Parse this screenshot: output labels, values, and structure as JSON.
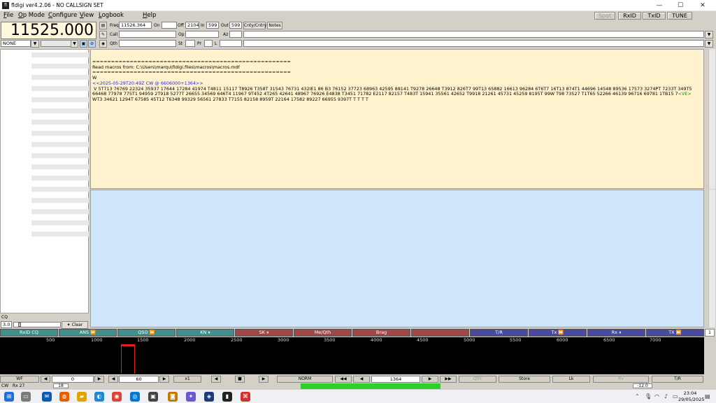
{
  "window": {
    "title": "fldigi ver4.2.06 - NO CALLSIGN SET",
    "icon_text": "fl"
  },
  "window_controls": {
    "minimize": "—",
    "maximize": "☐",
    "close": "✕"
  },
  "menu": [
    "File",
    "Op Mode",
    "Configure",
    "View",
    "Logbook",
    "Help"
  ],
  "mode_buttons": {
    "spot": "Spot",
    "rxid": "RxID",
    "txid": "TxID",
    "tune": "TUNE"
  },
  "log": {
    "frequency_display": "11525.000",
    "freq_label": "Freq",
    "freq_value": "11526.364",
    "on_label": "On",
    "on_value": "",
    "off_label": "Off",
    "off_value": "2104",
    "in_label": "In",
    "in_value": "599",
    "out_label": "Out",
    "out_value": "599",
    "cnty_label": "Cnty/Cntry",
    "notes_label": "Notes",
    "call_label": "Call",
    "op_label": "Op",
    "az_label": "Az",
    "qth_label": "Qth",
    "st_label": "St",
    "pr_label": "Pr",
    "l_label": "L",
    "band_select": "NONE"
  },
  "rx": {
    "line1": "=====================================================",
    "line2": "Read macros from: C:\\Users\\marqu\\fldigi.files\\macros\\macros.mdf",
    "line3": "=====================================================",
    "line4": "W",
    "timestamp": "<<2025-05-29T20:49Z CW @ 6606000+1364>>",
    "body1": " V 5T713 76769 22324 35937 17644 17284 41974 T4811 15117 T8926 T358T 31543 76731 432IE1 86 B3 76152 37723 68963 42595 88141 T9278 26648 T3912 826T7 99T13 65882 16613 96284 6T6T7 16T13 874T1 44696 14548 89536 17573 3274PT 7233T 349T5 66468 77978 775T1 94959 2T918 5277T 26655 34569 646T4 11967 9T452 4T265 42641 48967 76926 E4838 T3451 71782 E2117 82157 T483T 15941 35561 42652 T9918 21261 45731 45259 8195T 99W T98 73527 T1T65 52266 46139 96716 69781 1TB15 7",
    "ve": "<VE>",
    "body2": " WT3 34621 1294T 67585 45T12 T6348 99329 56561 27833 T7155 82158 8959T 22164 17582 89227 66955 9397T T T T T"
  },
  "sidepanel": {
    "cq_label": "CQ",
    "level": "3.0",
    "clear_label": "Clear"
  },
  "macros": [
    {
      "label": "RxID CQ",
      "color": "#3f8f8a"
    },
    {
      "label": "ANS ⏩",
      "color": "#3f8f8a"
    },
    {
      "label": "QSO ⏩",
      "color": "#3f8f8a"
    },
    {
      "label": "KN ⏸",
      "color": "#3f8f8a"
    },
    {
      "label": "SK ⏸",
      "color": "#a04848"
    },
    {
      "label": "Me/Qth",
      "color": "#a04848"
    },
    {
      "label": "Brag",
      "color": "#a04848"
    },
    {
      "label": "",
      "color": "#a04848"
    },
    {
      "label": "T/R",
      "color": "#4a4aa0"
    },
    {
      "label": "Tx ⏩",
      "color": "#4a4aa0"
    },
    {
      "label": "Rx ⏸",
      "color": "#4a4aa0"
    },
    {
      "label": "TX ⏩",
      "color": "#4a4aa0"
    }
  ],
  "macro_page": "1",
  "scale_ticks": [
    "500",
    "1000",
    "1500",
    "2000",
    "2500",
    "3000",
    "3500",
    "4000",
    "4500",
    "5000",
    "5500",
    "6000",
    "6500",
    "7000"
  ],
  "controls": {
    "wf_label": "WF",
    "wf_value": "0",
    "speed_value": "60",
    "zoom": "x1",
    "mode": "NORM",
    "carrier": "1364",
    "qsy": "QSY",
    "store": "Store",
    "lk": "Lk",
    "rv": "Rv",
    "tr": "T/R"
  },
  "status": {
    "mode": "CW",
    "rx": "Rx 27",
    "level": "18",
    "db": "-12.0"
  },
  "taskbar": {
    "time": "23:04",
    "date": "29/05/2025"
  }
}
